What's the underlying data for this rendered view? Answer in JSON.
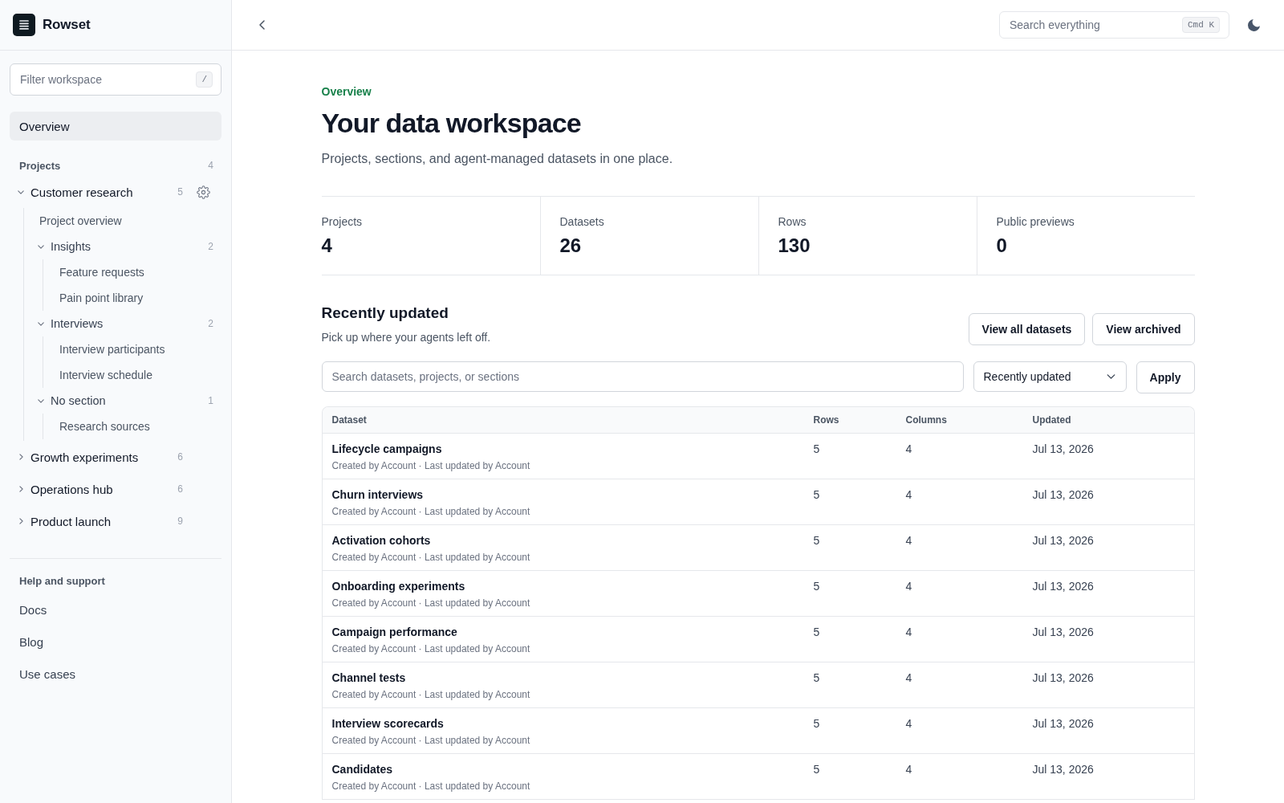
{
  "sidebar": {
    "brand": {
      "name": "Rowset"
    },
    "filter": {
      "placeholder": "Filter workspace",
      "shortcut": "/"
    },
    "nav": [
      {
        "label": "Overview",
        "selected": true
      }
    ],
    "projects": {
      "heading": "Projects",
      "count": "4",
      "items": [
        {
          "kind": "project",
          "label": "Customer research",
          "count": "5",
          "expanded": true,
          "settings_icon": true,
          "children": [
            {
              "kind": "page",
              "label": "Project overview"
            },
            {
              "kind": "section",
              "label": "Insights",
              "count": "2",
              "expanded": true,
              "children": [
                {
                  "kind": "dataset",
                  "label": "Feature requests"
                },
                {
                  "kind": "dataset",
                  "label": "Pain point library"
                }
              ]
            },
            {
              "kind": "section",
              "label": "Interviews",
              "count": "2",
              "expanded": true,
              "children": [
                {
                  "kind": "dataset",
                  "label": "Interview participants"
                },
                {
                  "kind": "dataset",
                  "label": "Interview schedule"
                }
              ]
            },
            {
              "kind": "section",
              "label": "No section",
              "count": "1",
              "expanded": true,
              "children": [
                {
                  "kind": "dataset",
                  "label": "Research sources"
                }
              ]
            }
          ]
        },
        {
          "kind": "project",
          "label": "Growth experiments",
          "count": "6",
          "expanded": false,
          "settings_icon": false
        },
        {
          "kind": "project",
          "label": "Operations hub",
          "count": "6",
          "expanded": false,
          "settings_icon": false
        },
        {
          "kind": "project",
          "label": "Product launch",
          "count": "9",
          "expanded": false,
          "settings_icon": false
        }
      ]
    },
    "help": {
      "heading": "Help and support",
      "links": [
        "Docs",
        "Blog",
        "Use cases"
      ]
    }
  },
  "topbar": {
    "search": {
      "placeholder": "Search everything",
      "shortcut": "Cmd K"
    }
  },
  "page": {
    "eyebrow": "Overview",
    "title": "Your data workspace",
    "subtitle": "Projects, sections, and agent-managed datasets in one place."
  },
  "stats": [
    {
      "label": "Projects",
      "value": "4"
    },
    {
      "label": "Datasets",
      "value": "26"
    },
    {
      "label": "Rows",
      "value": "130"
    },
    {
      "label": "Public previews",
      "value": "0"
    }
  ],
  "recent": {
    "heading": "Recently updated",
    "subheading": "Pick up where your agents left off.",
    "buttons": [
      "View all datasets",
      "View archived"
    ],
    "search": {
      "placeholder": "Search datasets, projects, or sections"
    },
    "sort": {
      "value": "Recently updated"
    },
    "apply_button": "Apply"
  },
  "table": {
    "columns": [
      "Dataset",
      "Rows",
      "Columns",
      "Updated"
    ],
    "rows": [
      {
        "name": "Lifecycle campaigns",
        "meta": "Created by Account · Last updated by Account",
        "rows": "5",
        "columns": "4",
        "updated": "Jul 13, 2026"
      },
      {
        "name": "Churn interviews",
        "meta": "Created by Account · Last updated by Account",
        "rows": "5",
        "columns": "4",
        "updated": "Jul 13, 2026"
      },
      {
        "name": "Activation cohorts",
        "meta": "Created by Account · Last updated by Account",
        "rows": "5",
        "columns": "4",
        "updated": "Jul 13, 2026"
      },
      {
        "name": "Onboarding experiments",
        "meta": "Created by Account · Last updated by Account",
        "rows": "5",
        "columns": "4",
        "updated": "Jul 13, 2026"
      },
      {
        "name": "Campaign performance",
        "meta": "Created by Account · Last updated by Account",
        "rows": "5",
        "columns": "4",
        "updated": "Jul 13, 2026"
      },
      {
        "name": "Channel tests",
        "meta": "Created by Account · Last updated by Account",
        "rows": "5",
        "columns": "4",
        "updated": "Jul 13, 2026"
      },
      {
        "name": "Interview scorecards",
        "meta": "Created by Account · Last updated by Account",
        "rows": "5",
        "columns": "4",
        "updated": "Jul 13, 2026"
      },
      {
        "name": "Candidates",
        "meta": "Created by Account · Last updated by Account",
        "rows": "5",
        "columns": "4",
        "updated": "Jul 13, 2026"
      }
    ]
  }
}
